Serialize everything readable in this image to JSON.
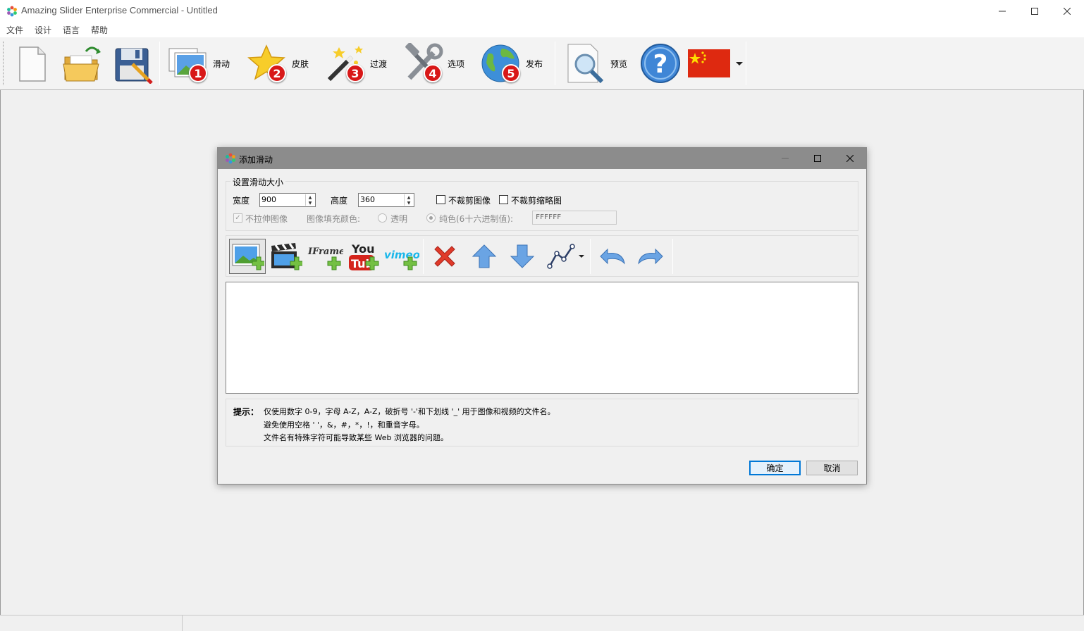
{
  "window": {
    "title": "Amazing Slider Enterprise Commercial - Untitled"
  },
  "menu": {
    "items": [
      "文件",
      "设计",
      "语言",
      "帮助"
    ]
  },
  "toolbar": {
    "slides_label": "滑动",
    "skins_label": "皮肤",
    "transitions_label": "过渡",
    "options_label": "选项",
    "publish_label": "发布",
    "preview_label": "预览",
    "badges": [
      "1",
      "2",
      "3",
      "4",
      "5"
    ]
  },
  "dialog": {
    "title": "添加滑动",
    "size_group_label": "设置滑动大小",
    "width_label": "宽度",
    "width_value": "900",
    "height_label": "高度",
    "height_value": "360",
    "no_crop_image_label": "不裁剪图像",
    "no_crop_thumb_label": "不裁剪缩略图",
    "no_stretch_label": "不拉伸图像",
    "fill_color_label": "图像填充颜色:",
    "transparent_label": "透明",
    "solid_label": "纯色(6十六进制值):",
    "hex_value": "FFFFFF",
    "iframe_label": "IFrame",
    "youtube_label_top": "You",
    "youtube_label_bottom": "Tub",
    "vimeo_label": "vimeo",
    "hint_title": "提示：",
    "hint_lines": [
      "仅使用数字 0-9，字母 A-Z，A-Z，破折号 '-'和下划线 '_' 用于图像和视频的文件名。",
      "避免使用空格 ' '，&，#，*，!，和重音字母。",
      "文件名有特殊字符可能导致某些 Web 浏览器的问题。"
    ],
    "ok_label": "确定",
    "cancel_label": "取消"
  }
}
